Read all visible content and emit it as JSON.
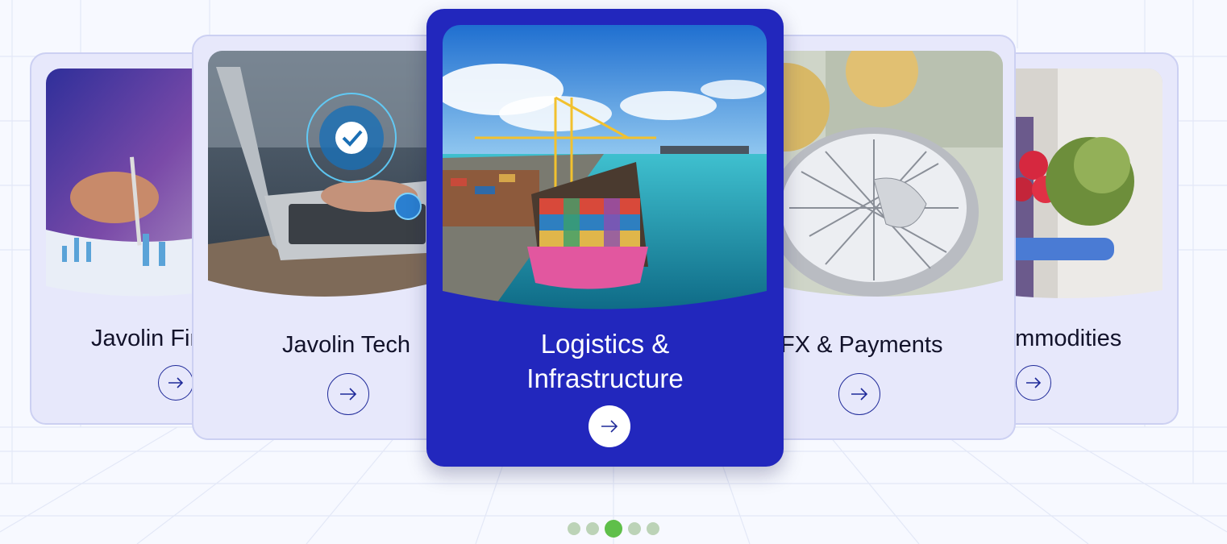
{
  "carousel": {
    "cards": [
      {
        "id": "finance",
        "label": "Javolin Finance"
      },
      {
        "id": "tech",
        "label": "Javolin Tech"
      },
      {
        "id": "logistics",
        "label": "Logistics & Infrastructure"
      },
      {
        "id": "fx",
        "label": "FX & Payments"
      },
      {
        "id": "commodities",
        "label": "Commodities"
      }
    ],
    "active_index": 2,
    "dot_count": 5
  },
  "colors": {
    "active_card_bg": "#2227bd",
    "card_bg": "#e7e8fb",
    "dot_active": "#5fbf4a",
    "dot_inactive": "#bcd3b7"
  },
  "icons": {
    "arrow": "arrow-right-icon"
  }
}
